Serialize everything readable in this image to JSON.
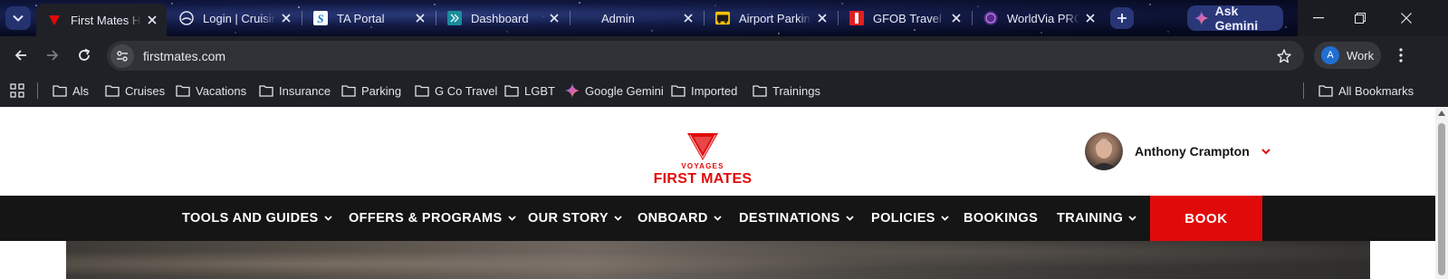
{
  "browser": {
    "tabs": [
      {
        "title": "First Mates Ho",
        "favicon": "virgin-heart-icon",
        "active": true
      },
      {
        "title": "Login | Cruising",
        "favicon": "globe-ship-icon",
        "active": false
      },
      {
        "title": "TA Portal",
        "favicon": "s-logo-icon",
        "active": false
      },
      {
        "title": "Dashboard",
        "favicon": "teal-logo-icon",
        "active": false
      },
      {
        "title": "Admin",
        "favicon": "none",
        "active": false
      },
      {
        "title": "Airport Parking",
        "favicon": "parking-logo-icon",
        "active": false
      },
      {
        "title": "GFOB Travel Ac",
        "favicon": "red-logo-icon",
        "active": false
      },
      {
        "title": "WorldVia PRO",
        "favicon": "purple-globe-icon",
        "active": false
      }
    ],
    "ask_gemini_label": "Ask Gemini",
    "url": "firstmates.com",
    "profile_label": "Work",
    "profile_initial": "A",
    "bookmarks": [
      {
        "label": "Als",
        "icon": "folder-icon"
      },
      {
        "label": "Cruises",
        "icon": "folder-icon"
      },
      {
        "label": "Vacations",
        "icon": "folder-icon"
      },
      {
        "label": "Insurance",
        "icon": "folder-icon"
      },
      {
        "label": "Parking",
        "icon": "folder-icon"
      },
      {
        "label": "G Co Travel",
        "icon": "folder-icon"
      },
      {
        "label": "LGBT",
        "icon": "folder-icon"
      },
      {
        "label": "Google Gemini",
        "icon": "gemini-icon"
      },
      {
        "label": "Imported",
        "icon": "folder-icon"
      },
      {
        "label": "Trainings",
        "icon": "folder-icon"
      }
    ],
    "all_bookmarks_label": "All Bookmarks"
  },
  "site": {
    "logo_small": "VOYAGES",
    "logo_name": "FIRST MATES",
    "user_name": "Anthony Crampton",
    "nav": [
      {
        "label": "TOOLS AND GUIDES",
        "dropdown": true
      },
      {
        "label": "OFFERS & PROGRAMS",
        "dropdown": true
      },
      {
        "label": "OUR STORY",
        "dropdown": true
      },
      {
        "label": "ONBOARD",
        "dropdown": true
      },
      {
        "label": "DESTINATIONS",
        "dropdown": true
      },
      {
        "label": "POLICIES",
        "dropdown": true
      },
      {
        "label": "BOOKINGS",
        "dropdown": false
      },
      {
        "label": "TRAINING",
        "dropdown": true
      }
    ],
    "book_label": "BOOK",
    "accent_color": "#e10a0a"
  }
}
